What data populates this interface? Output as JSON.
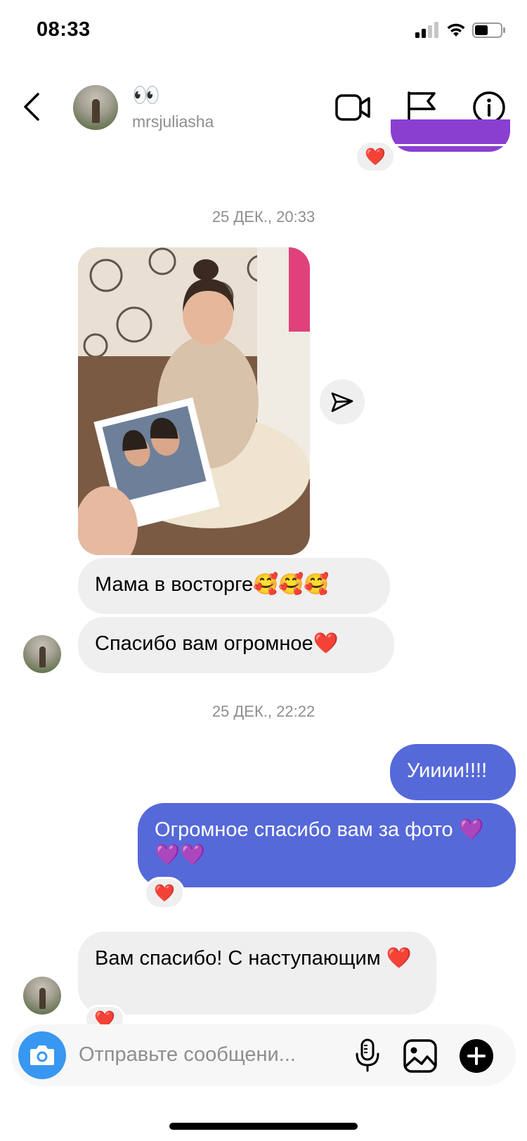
{
  "status_bar": {
    "time": "08:33"
  },
  "header": {
    "display_name": "👀",
    "username": "mrsjuliasha"
  },
  "conversation": {
    "top_reaction": "❤️",
    "timestamp_1": "25 ДЕК., 20:33",
    "message_1": "Мама в восторге🥰🥰🥰",
    "message_2": "Спасибо вам огромное❤️",
    "timestamp_2": "25 ДЕК., 22:22",
    "sent_1": "Уииии!!!!",
    "sent_2": "Огромное спасибо вам за фото 💜💜💜",
    "sent_2_reaction": "❤️",
    "message_3": "Вам спасибо! С наступающим ❤️",
    "message_3_reaction": "❤️"
  },
  "composer": {
    "placeholder": "Отправьте сообщени..."
  },
  "colors": {
    "sent_bubble": "#5669d9",
    "received_bubble": "#efefef",
    "camera_button": "#3897f0",
    "top_bubble_edge": "#8a3fd1"
  },
  "icons": [
    "back-icon",
    "video-call-icon",
    "flag-icon",
    "info-icon",
    "share-icon",
    "camera-icon",
    "microphone-icon",
    "gallery-icon",
    "plus-icon"
  ]
}
